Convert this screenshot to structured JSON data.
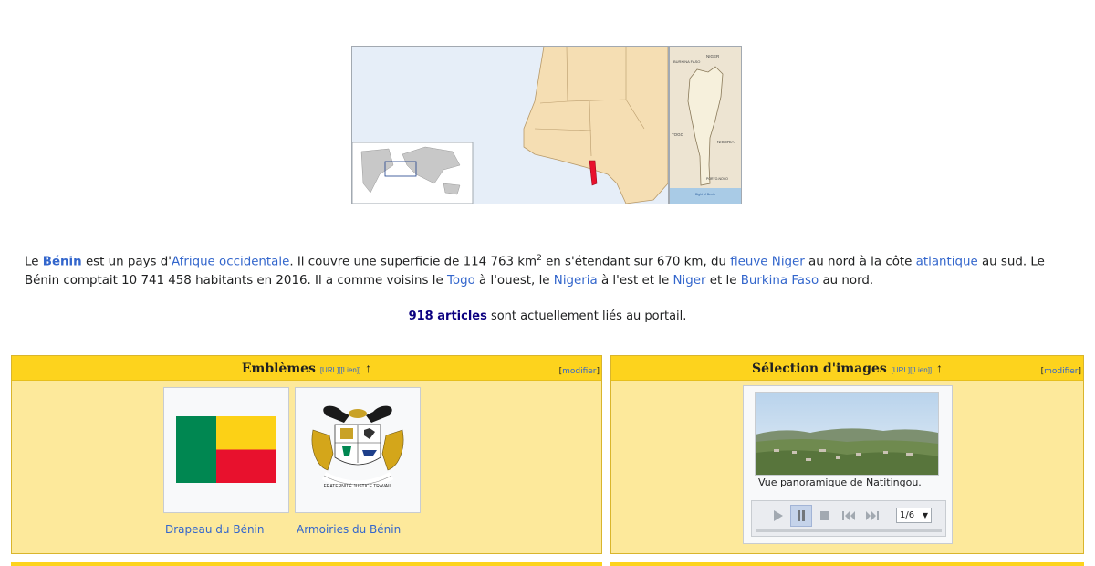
{
  "maps": {
    "benin_labels": {
      "burkina": "BURKINA FASO",
      "niger": "NIGER",
      "togo": "TOGO",
      "nigeria": "NIGERIA",
      "porto": "PORTO-NOVO",
      "gulf": "Bight of Benin"
    }
  },
  "intro": {
    "p1": "Le ",
    "benin": "Bénin",
    "p2": " est un pays d'",
    "afrique": "Afrique occidentale",
    "p3": ". Il couvre une superficie de 114 763 km",
    "sup": "2",
    "p4": " en s'étendant sur 670 km, du ",
    "fleuve": "fleuve Niger",
    "p5": " au nord à la côte ",
    "atlantique": "atlantique",
    "p6": " au sud. Le Bénin comptait 10 741 458 habitants en 2016. Il a comme voisins le ",
    "togo": "Togo",
    "p7": " à l'ouest, le ",
    "nigeria": "Nigeria",
    "p8": " à l'est et le ",
    "niger": "Niger",
    "p9": " et le ",
    "burkina": "Burkina Faso",
    "p10": " au nord."
  },
  "count": {
    "number": "918 articles",
    "rest": " sont actuellement liés au portail."
  },
  "emblemes": {
    "title": "Emblèmes",
    "url": "[URL]",
    "lien": "[[Lien]]",
    "arrow": "↑",
    "modifier": "modifier",
    "flag_caption": "Drapeau du Bénin",
    "arms_caption": "Armoiries du Bénin",
    "motto": "FRATERNITÉ JUSTICE TRAVAIL"
  },
  "images": {
    "title": "Sélection d'images",
    "url": "[URL]",
    "lien": "[[Lien]]",
    "arrow": "↑",
    "modifier": "modifier",
    "photo_caption": "Vue panoramique de Natitingou.",
    "counter": "1/6"
  },
  "colors": {
    "header": "#fdd31d",
    "body": "#fde99b",
    "link": "#3366cc",
    "benin_red": "#e8112d",
    "benin_green": "#008751",
    "benin_yellow": "#fcd116"
  }
}
